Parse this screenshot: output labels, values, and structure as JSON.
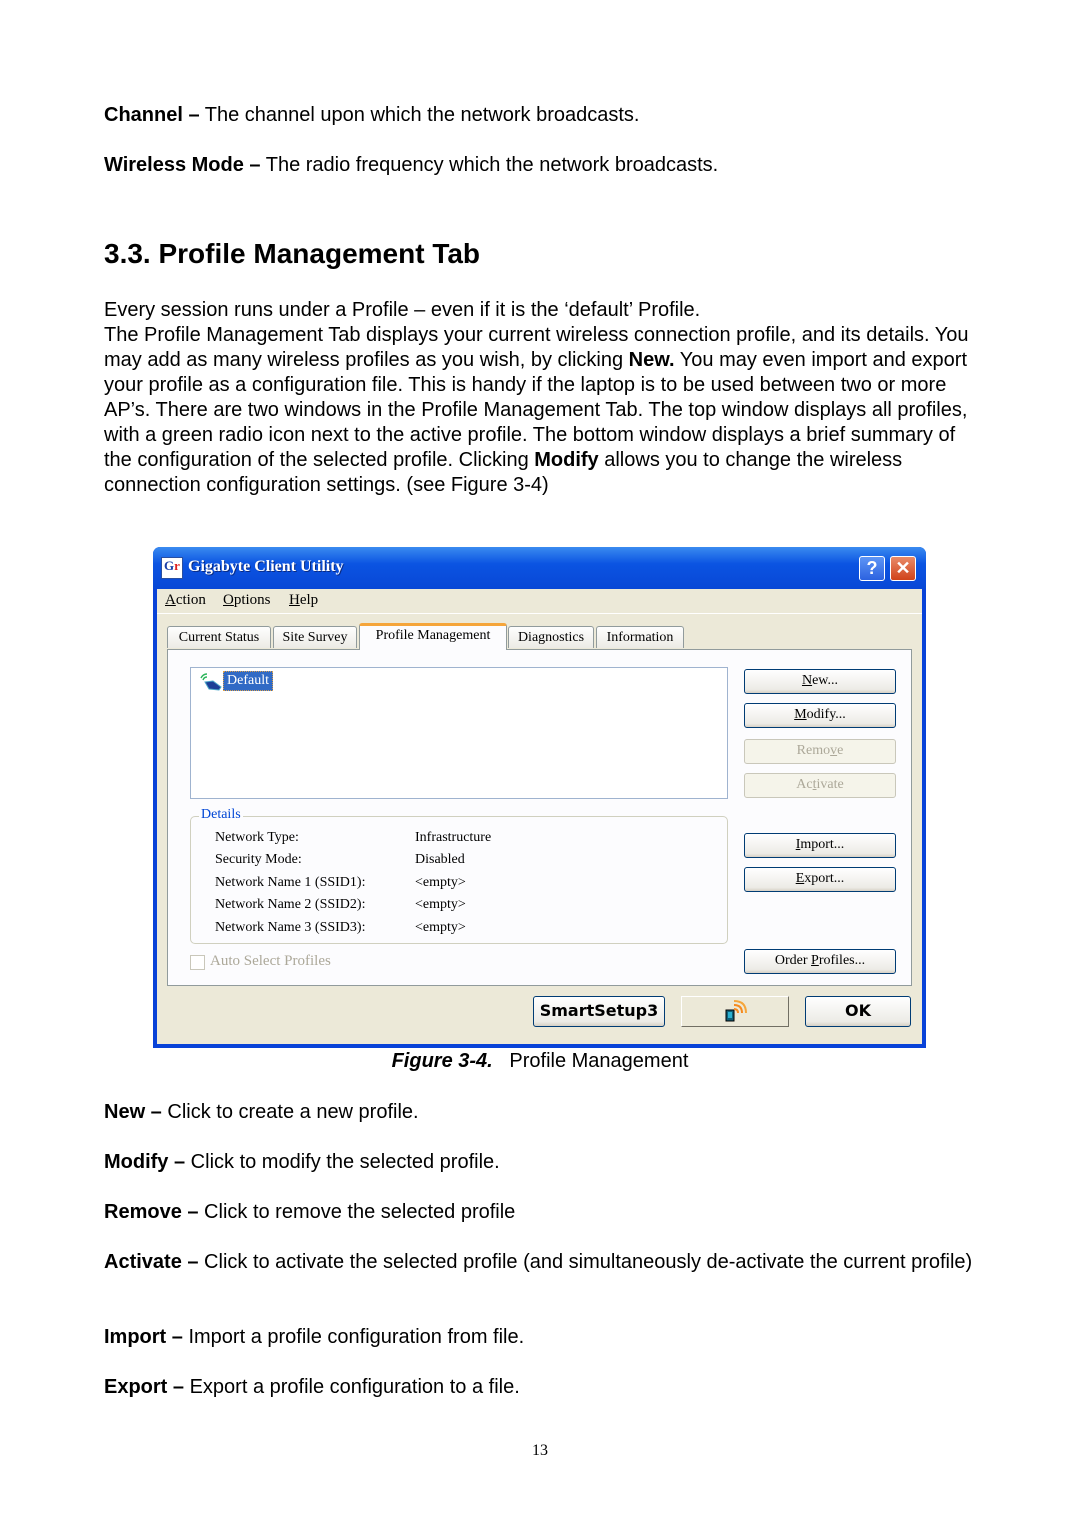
{
  "intro": {
    "channel_term": "Channel –",
    "channel_desc": " The channel upon which the network broadcasts.",
    "wireless_term": "Wireless Mode –",
    "wireless_desc": " The radio frequency which the network broadcasts."
  },
  "section": {
    "heading": "3.3. Profile Management Tab",
    "p1": "Every session runs under a Profile – even if it is the ‘default’ Profile.",
    "p2_a": "The Profile Management Tab displays your current wireless connection profile, and its details.   You may add as many wireless profiles as you wish, by clicking ",
    "p2_new": "New.",
    "p2_b": "   You may even import and export your profile as a configuration file. This is handy if the laptop is to be used between two or more AP’s.   There are two windows in the Profile Management Tab.   The top window displays all profiles, with a green radio icon next to the active profile. The bottom window displays a brief summary of the configuration of the selected profile.   Clicking ",
    "p2_modify": "Modify",
    "p2_c": " allows you to change the wireless connection configuration settings. ",
    "p2_ref": "(see Figure 3-4)"
  },
  "window": {
    "title": "Gigabyte Client Utility",
    "help_glyph": "?",
    "close_glyph": "✕",
    "menu": [
      {
        "key": "A",
        "rest": "ction"
      },
      {
        "key": "O",
        "rest": "ptions"
      },
      {
        "key": "H",
        "rest": "elp"
      }
    ],
    "tabs": [
      "Current Status",
      "Site Survey",
      "Profile Management",
      "Diagnostics",
      "Information"
    ],
    "active_tab": "Profile Management",
    "profiles": [
      {
        "name": "Default",
        "active": true,
        "selected": true
      }
    ],
    "buttons": {
      "new": {
        "key": "N",
        "rest": "ew..."
      },
      "modify": {
        "key": "M",
        "rest": "odify..."
      },
      "remove": {
        "pre": "Remo",
        "key": "v",
        "rest": "e",
        "enabled": false
      },
      "activate": {
        "pre": "Ac",
        "key": "t",
        "rest": "ivate",
        "enabled": false
      },
      "import": {
        "key": "I",
        "rest": "mport..."
      },
      "export": {
        "key": "E",
        "rest": "xport..."
      },
      "order": {
        "pre": "Order ",
        "key": "P",
        "rest": "rofiles..."
      }
    },
    "details": {
      "legend": "Details",
      "rows": [
        {
          "label": "Network Type:",
          "value": "Infrastructure"
        },
        {
          "label": "Security Mode:",
          "value": "Disabled"
        },
        {
          "label": "Network Name 1 (SSID1):",
          "value": "<empty>"
        },
        {
          "label": "Network Name 2 (SSID2):",
          "value": "<empty>"
        },
        {
          "label": "Network Name 3 (SSID3):",
          "value": "<empty>"
        }
      ]
    },
    "auto_select": {
      "label": "Auto Select Profiles",
      "checked": false,
      "enabled": false
    },
    "footer": {
      "smartsetup": "SmartSetup3",
      "ok": "OK"
    }
  },
  "caption": {
    "label": "Figure 3-4.",
    "text": "   Profile Management"
  },
  "definitions": [
    {
      "term": "New –",
      "desc": " Click to create a new profile."
    },
    {
      "term": "Modify –",
      "desc": " Click to modify the selected profile."
    },
    {
      "term": "Remove –",
      "desc": " Click to remove the selected profile"
    },
    {
      "term": "Activate –",
      "desc": " Click to activate the selected profile (and simultaneously de-activate the current profile)"
    },
    {
      "term": "Import –",
      "desc": " Import a profile configuration from file."
    },
    {
      "term": "Export –",
      "desc": " Export a profile configuration to a file."
    }
  ],
  "page_number": "13"
}
